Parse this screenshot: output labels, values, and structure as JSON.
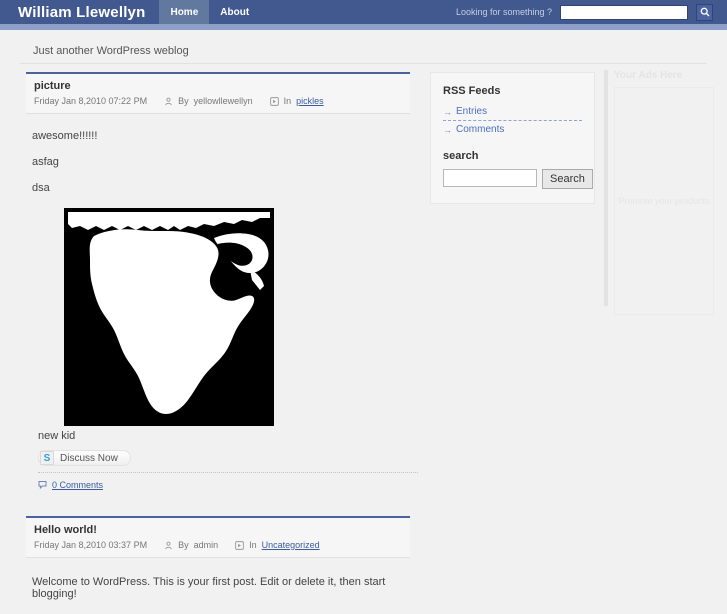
{
  "header": {
    "site_title": "William Llewellyn",
    "nav": [
      {
        "label": "Home",
        "active": true
      },
      {
        "label": "About",
        "active": false
      }
    ],
    "search_label": "Looking for something ?",
    "search_value": "",
    "search_placeholder": "",
    "search_icon": "magnifier-icon"
  },
  "tagline": "Just another WordPress weblog",
  "posts": [
    {
      "title": "picture",
      "date": "Friday Jan 8,2010 07:22 PM",
      "by_label": "By",
      "author": "yellowllewellyn",
      "in_label": "In",
      "category": "pickles",
      "paragraphs": [
        "awesome!!!!!!",
        "asfag",
        "dsa"
      ],
      "image_alt": "africa-map",
      "after_image_text": "new kid",
      "discuss_label": "Discuss Now",
      "discuss_icon_letter": "S",
      "comments_label": "0 Comments"
    },
    {
      "title": "Hello world!",
      "date": "Friday Jan 8,2010 03:37 PM",
      "by_label": "By",
      "author": "admin",
      "in_label": "In",
      "category": "Uncategorized",
      "paragraphs": [
        "Welcome to WordPress. This is your first post. Edit or delete it, then start blogging!"
      ]
    }
  ],
  "sidebar": {
    "rss_heading": "RSS Feeds",
    "rss_links": [
      {
        "label": "Entries",
        "arrow": "→"
      },
      {
        "label": "Comments",
        "arrow": "→"
      }
    ],
    "search_heading": "search",
    "search_value": "",
    "search_button": "Search"
  },
  "ads": {
    "title": "Your Ads Here",
    "placeholder": "Promote your products"
  },
  "colors": {
    "header_blue": "#41598f",
    "header_strip": "#8e9fc9",
    "nav_active": "#61789f",
    "link_blue": "#3b5ca0",
    "post_rule": "#4a63a0"
  }
}
